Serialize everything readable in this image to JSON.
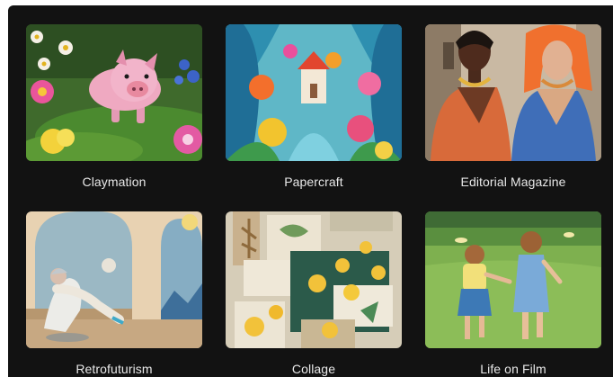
{
  "styles": [
    {
      "label": "Claymation"
    },
    {
      "label": "Papercraft"
    },
    {
      "label": "Editorial Magazine"
    },
    {
      "label": "Retrofuturism"
    },
    {
      "label": "Collage"
    },
    {
      "label": "Life on Film"
    }
  ]
}
